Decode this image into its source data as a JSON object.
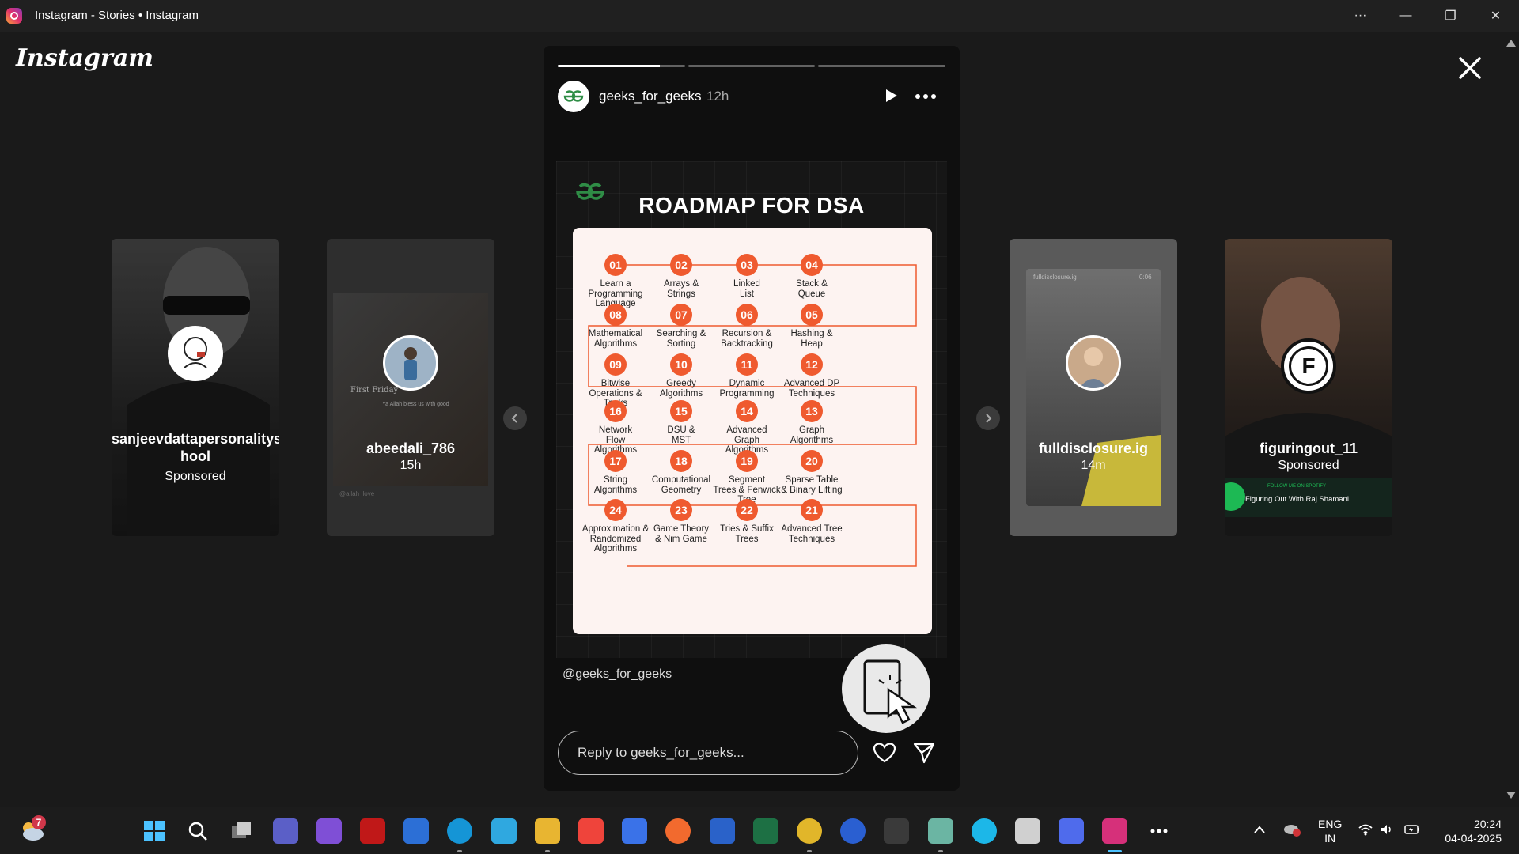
{
  "window": {
    "title": "Instagram - Stories • Instagram",
    "more_label": "···",
    "minimize_label": "—",
    "maximize_label": "❐",
    "close_label": "✕"
  },
  "brand": {
    "logo_text": "Instagram"
  },
  "previews": [
    {
      "name": "sanjeevdattapersonalitysc hool",
      "sub": "Sponsored"
    },
    {
      "name": "abeedali_786",
      "sub": "15h"
    },
    {
      "name": "fulldisclosure.ig",
      "sub": "14m"
    },
    {
      "name": "figuringout_11",
      "sub": "Sponsored"
    }
  ],
  "preview_extras": {
    "p2_caption": "First Friday",
    "p2_subcaption": "Ya Allah bless us with good",
    "p2_tag": "@allah_love_",
    "p3_header": "fulldisclosure.ig",
    "p3_time": "0:06",
    "p4_badge_letter": "F",
    "p4_spotify_top": "FOLLOW ME ON SPOTIFY",
    "p4_spotify_title": "Figuring Out With Raj Shamani"
  },
  "story": {
    "username": "geeks_for_geeks",
    "time": "12h",
    "progress": [
      1.0,
      0.0,
      0.0
    ],
    "progress_first_fill": 0.8,
    "mention": "@geeks_for_geeks",
    "reply_placeholder": "Reply to geeks_for_geeks...",
    "image": {
      "title": "ROADMAP FOR DSA",
      "steps": [
        {
          "num": "01",
          "label": "Learn a\nProgramming\nLanguage"
        },
        {
          "num": "02",
          "label": "Arrays &\nStrings"
        },
        {
          "num": "03",
          "label": "Linked\nList"
        },
        {
          "num": "04",
          "label": "Stack &\nQueue"
        },
        {
          "num": "08",
          "label": "Mathematical\nAlgorithms"
        },
        {
          "num": "07",
          "label": "Searching &\nSorting"
        },
        {
          "num": "06",
          "label": "Recursion &\nBacktracking"
        },
        {
          "num": "05",
          "label": "Hashing &\nHeap"
        },
        {
          "num": "09",
          "label": "Bitwise\nOperations &\nTricks"
        },
        {
          "num": "10",
          "label": "Greedy\nAlgorithms"
        },
        {
          "num": "11",
          "label": "Dynamic\nProgramming"
        },
        {
          "num": "12",
          "label": "Advanced DP\nTechniques"
        },
        {
          "num": "16",
          "label": "Network\nFlow\nAlgorithms"
        },
        {
          "num": "15",
          "label": "DSU &\nMST"
        },
        {
          "num": "14",
          "label": "Advanced\nGraph\nAlgorithms"
        },
        {
          "num": "13",
          "label": "Graph\nAlgorithms"
        },
        {
          "num": "17",
          "label": "String\nAlgorithms"
        },
        {
          "num": "18",
          "label": "Computational\nGeometry"
        },
        {
          "num": "19",
          "label": "Segment\nTrees & Fenwick\nTree"
        },
        {
          "num": "20",
          "label": "Sparse Table\n& Binary Lifting"
        },
        {
          "num": "24",
          "label": "Approximation &\nRandomized\nAlgorithms"
        },
        {
          "num": "23",
          "label": "Game Theory\n& Nim Game"
        },
        {
          "num": "22",
          "label": "Tries & Suffix\nTrees"
        },
        {
          "num": "21",
          "label": "Advanced Tree\nTechniques"
        }
      ]
    }
  },
  "taskbar": {
    "weather_badge": "7",
    "lang_top": "ENG",
    "lang_bottom": "IN",
    "clock_time": "20:24",
    "clock_date": "04-04-2025",
    "apps": [
      "windows-start",
      "search",
      "task-view",
      "teams",
      "copilot",
      "mcafee",
      "store",
      "edge",
      "safari",
      "file-explorer",
      "anydesk",
      "ai-assistant",
      "firefox",
      "calendar",
      "excel",
      "chrome",
      "ccleaner",
      "font-viewer",
      "chatgpt",
      "alexa",
      "app-placeholder",
      "deepseek",
      "instagram",
      "more-apps"
    ]
  }
}
